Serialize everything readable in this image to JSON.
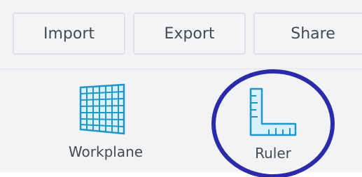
{
  "toolbar": {
    "import_label": "Import",
    "export_label": "Export",
    "share_label": "Share"
  },
  "tools": [
    {
      "label": "Workplane",
      "icon": "workplane-icon"
    },
    {
      "label": "Ruler",
      "icon": "ruler-icon"
    }
  ],
  "colors": {
    "accent": "#1e96c8",
    "annotation": "#2b2aa8",
    "text": "#464a4f",
    "background": "#f2f3f5"
  }
}
